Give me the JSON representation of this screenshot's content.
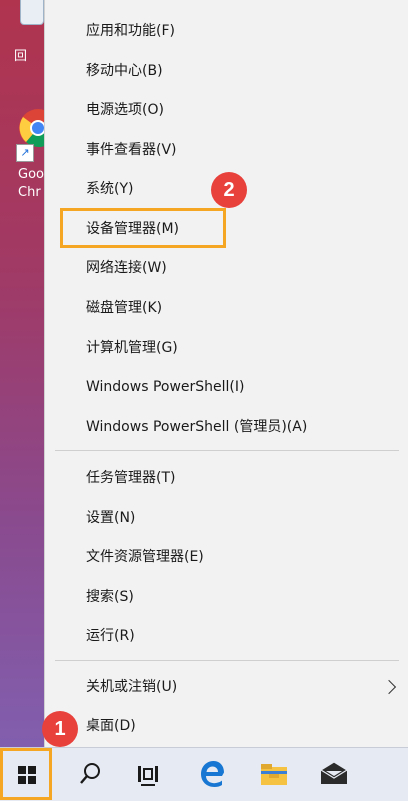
{
  "desktop": {
    "recycle_label": "回",
    "chrome_label_line1": "Goo",
    "chrome_label_line2": "Chr"
  },
  "menu": {
    "items": [
      "应用和功能(F)",
      "移动中心(B)",
      "电源选项(O)",
      "事件查看器(V)",
      "系统(Y)",
      "设备管理器(M)",
      "网络连接(W)",
      "磁盘管理(K)",
      "计算机管理(G)",
      "Windows PowerShell(I)",
      "Windows PowerShell (管理员)(A)",
      "任务管理器(T)",
      "设置(N)",
      "文件资源管理器(E)",
      "搜索(S)",
      "运行(R)",
      "关机或注销(U)",
      "桌面(D)"
    ]
  },
  "annotations": {
    "step1": "1",
    "step2": "2",
    "highlight_color": "#f5a623",
    "badge_color": "#e8413c"
  },
  "taskbar": {
    "icons": [
      "windows-start-icon",
      "search-icon",
      "task-view-icon",
      "edge-icon",
      "file-explorer-icon",
      "mail-icon"
    ]
  }
}
